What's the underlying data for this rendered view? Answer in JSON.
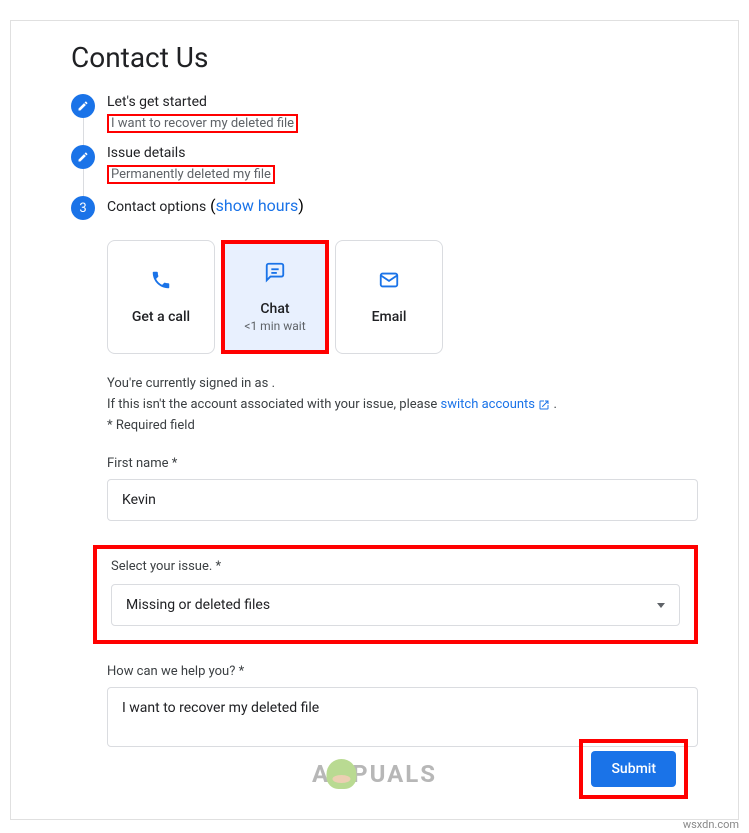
{
  "page_title": "Contact Us",
  "steps": [
    {
      "title": "Let's get started",
      "subtitle": "I want to recover my deleted file"
    },
    {
      "title": "Issue details",
      "subtitle": "Permanently deleted my file"
    },
    {
      "number": "3",
      "title": "Contact options",
      "link_text": "show hours"
    }
  ],
  "contact_options": [
    {
      "label": "Get a call",
      "sublabel": ""
    },
    {
      "label": "Chat",
      "sublabel": "<1 min wait"
    },
    {
      "label": "Email",
      "sublabel": ""
    }
  ],
  "info": {
    "signed_in_text": "You're currently signed in as",
    "switch_text": "If this isn't the account associated with your issue, please ",
    "switch_link": "switch accounts",
    "required_text": "* Required field",
    "period": "."
  },
  "form": {
    "first_name_label": "First name *",
    "first_name_value": "Kevin",
    "issue_label": "Select your issue. *",
    "issue_value": "Missing or deleted files",
    "help_label": "How can we help you? *",
    "help_value": "I want to recover my deleted file",
    "submit_label": "Submit"
  },
  "watermark": {
    "text_before": "A",
    "text_after": "PUALS"
  },
  "source": "wsxdn.com"
}
